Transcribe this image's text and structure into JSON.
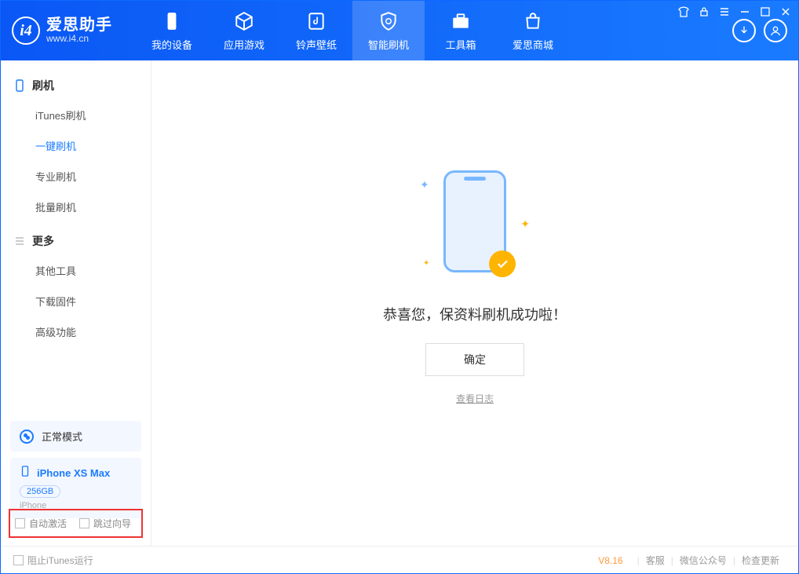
{
  "app": {
    "name_cn": "爱思助手",
    "url": "www.i4.cn"
  },
  "nav": [
    {
      "label": "我的设备"
    },
    {
      "label": "应用游戏"
    },
    {
      "label": "铃声壁纸"
    },
    {
      "label": "智能刷机"
    },
    {
      "label": "工具箱"
    },
    {
      "label": "爱思商城"
    }
  ],
  "sidebar": {
    "group1": {
      "title": "刷机",
      "items": [
        "iTunes刷机",
        "一键刷机",
        "专业刷机",
        "批量刷机"
      ]
    },
    "group2": {
      "title": "更多",
      "items": [
        "其他工具",
        "下载固件",
        "高级功能"
      ]
    },
    "mode": "正常模式",
    "device": {
      "name": "iPhone XS Max",
      "capacity": "256GB",
      "type": "iPhone"
    },
    "opt_auto_activate": "自动激活",
    "opt_skip_guide": "跳过向导"
  },
  "main": {
    "success_msg": "恭喜您，保资料刷机成功啦！",
    "ok_btn": "确定",
    "view_log": "查看日志"
  },
  "footer": {
    "block_itunes": "阻止iTunes运行",
    "version": "V8.16",
    "links": [
      "客服",
      "微信公众号",
      "检查更新"
    ]
  }
}
